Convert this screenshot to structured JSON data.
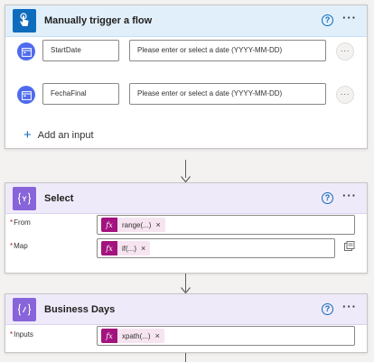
{
  "trigger": {
    "title": "Manually trigger a flow",
    "help": "?",
    "more": "···",
    "inputs": [
      {
        "name": "StartDate",
        "placeholder": "Please enter or select a date (YYYY-MM-DD)",
        "more": "···"
      },
      {
        "name": "FechaFinal",
        "placeholder": "Please enter or select a date (YYYY-MM-DD)",
        "more": "···"
      }
    ],
    "add_input": "Add an input"
  },
  "select": {
    "title": "Select",
    "help": "?",
    "more": "···",
    "from_label": "From",
    "from_token": "range(...)",
    "map_label": "Map",
    "map_token": "if(...)"
  },
  "business_days": {
    "title": "Business Days",
    "help": "?",
    "more": "···",
    "inputs_label": "Inputs",
    "inputs_token": "xpath(...)"
  },
  "common": {
    "required_mark": "*",
    "token_remove": "×",
    "fx": "fx"
  },
  "icons": {
    "trigger": "touch-hand-icon",
    "action": "data-operation-curly-icon",
    "date_input": "calendar-icon",
    "map_switch": "switch-to-text-mode-icon"
  },
  "colors": {
    "trigger_accent": "#0f6cbd",
    "action_accent": "#8764d9",
    "token_fx": "#a3137f",
    "required": "#a4262c"
  }
}
